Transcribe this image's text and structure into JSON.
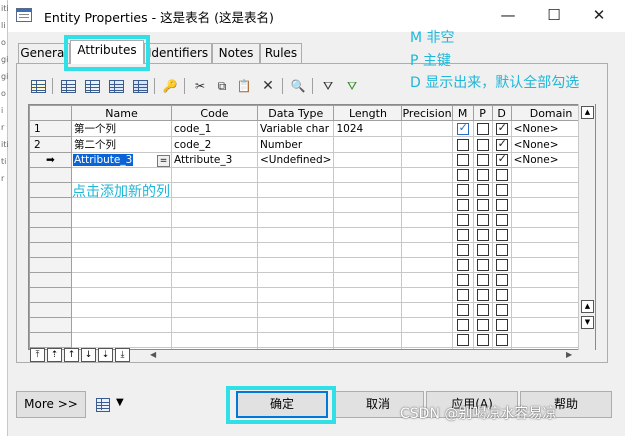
{
  "background": {
    "left_glyphs": [
      "iti",
      "li",
      "o",
      "gi",
      "gi",
      "o",
      "i",
      "r",
      "iti",
      "ti",
      "r"
    ]
  },
  "window": {
    "title": "Entity Properties - 这是表名 (这是表名)",
    "minimize_glyph": "—",
    "maximize_glyph": "☐",
    "close_glyph": "✕"
  },
  "tabs": [
    {
      "label": "General"
    },
    {
      "label": "Attributes",
      "active": true
    },
    {
      "label": "Identifiers"
    },
    {
      "label": "Notes"
    },
    {
      "label": "Rules"
    }
  ],
  "toolbar": {
    "icons": [
      "properties-icon",
      "insert-row-icon",
      "add-row-icon",
      "add-attributes-icon",
      "replicate-icon",
      "find-key-icon",
      "cut-icon",
      "copy-icon",
      "paste-icon",
      "delete-icon",
      "find-icon",
      "filter-icon",
      "filter-options-icon"
    ],
    "cut_glyph": "✂",
    "copy_glyph": "⧉",
    "paste_glyph": "📋",
    "delete_glyph": "✕",
    "find_glyph": "🔍",
    "filter_glyph": "⛛",
    "key_glyph": "🔑"
  },
  "grid": {
    "columns": [
      "Name",
      "Code",
      "Data Type",
      "Length",
      "Precision",
      "M",
      "P",
      "D",
      "Domain"
    ],
    "rows": [
      {
        "num": "1",
        "name": "第一个列",
        "code": "code_1",
        "data_type": "Variable char",
        "length": "1024",
        "precision": "",
        "m": true,
        "p": false,
        "d": true,
        "domain": "<None>"
      },
      {
        "num": "2",
        "name": "第二个列",
        "code": "code_2",
        "data_type": "Number",
        "length": "",
        "precision": "",
        "m": false,
        "p": false,
        "d": true,
        "domain": "<None>"
      },
      {
        "num": "➡",
        "name": "Attribute_3",
        "code": "Attribute_3",
        "data_type": "<Undefined>",
        "length": "",
        "precision": "",
        "m": false,
        "p": false,
        "d": true,
        "domain": "<None>",
        "editing": true,
        "edit_button": "="
      }
    ],
    "empty_rows": 13
  },
  "nav_buttons": [
    "⤒",
    "⇡",
    "↑",
    "↓",
    "⇣",
    "⤓"
  ],
  "scroll": {
    "up": "▲",
    "down": "▼",
    "top": "▲",
    "left": "◀",
    "right": "▶"
  },
  "buttons": {
    "more": "More >>",
    "ok": "确定",
    "cancel": "取消",
    "apply": "应用(A)",
    "help": "帮助"
  },
  "annotations": {
    "m": "M 非空",
    "p": "P  主键",
    "d": "D  显示出来，默认全部勾选",
    "add_column": "点击添加新的列"
  },
  "watermark": "CSDN @别喝凉水容易凉",
  "colors": {
    "highlight": "#30e0e6",
    "annotation": "#1fb7d8",
    "selection": "#0a64d8"
  }
}
